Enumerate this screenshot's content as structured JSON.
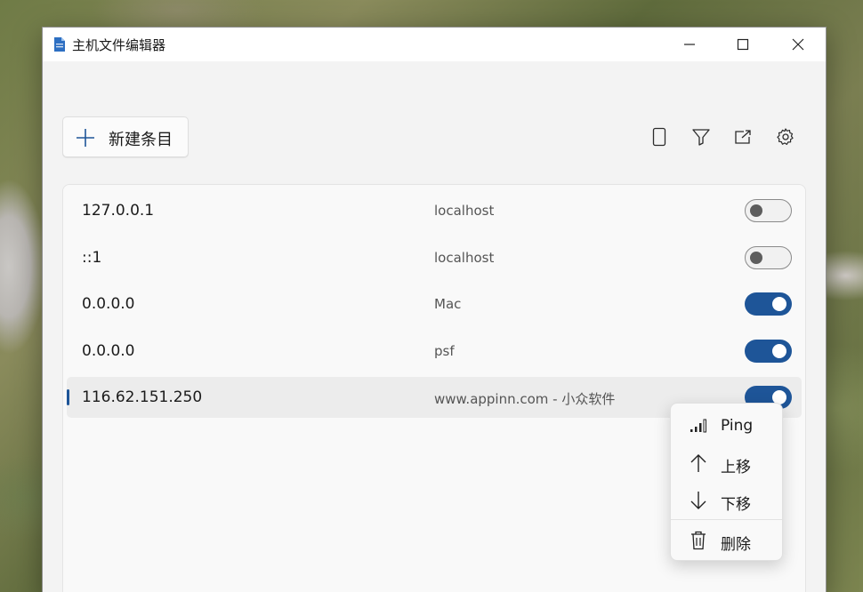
{
  "window": {
    "title": "主机文件编辑器"
  },
  "toolbar": {
    "new_entry_label": "新建条目",
    "icons": [
      "file-icon",
      "filter-icon",
      "share-icon",
      "settings-icon"
    ]
  },
  "entries": [
    {
      "ip": "127.0.0.1",
      "host": "localhost",
      "enabled": false
    },
    {
      "ip": "::1",
      "host": "localhost",
      "enabled": false
    },
    {
      "ip": "0.0.0.0",
      "host": "Mac",
      "enabled": true
    },
    {
      "ip": "0.0.0.0",
      "host": "psf",
      "enabled": true
    },
    {
      "ip": "116.62.151.250",
      "host": "www.appinn.com - 小众软件",
      "enabled": true,
      "selected": true
    }
  ],
  "context_menu": {
    "items": [
      {
        "label": "Ping",
        "icon": "signal-bars-icon"
      },
      {
        "label": "上移",
        "icon": "arrow-up-icon"
      },
      {
        "label": "下移",
        "icon": "arrow-down-icon"
      },
      {
        "label": "删除",
        "icon": "trash-icon"
      }
    ]
  },
  "colors": {
    "accent": "#1e5598",
    "window_bg": "#f3f3f3"
  }
}
